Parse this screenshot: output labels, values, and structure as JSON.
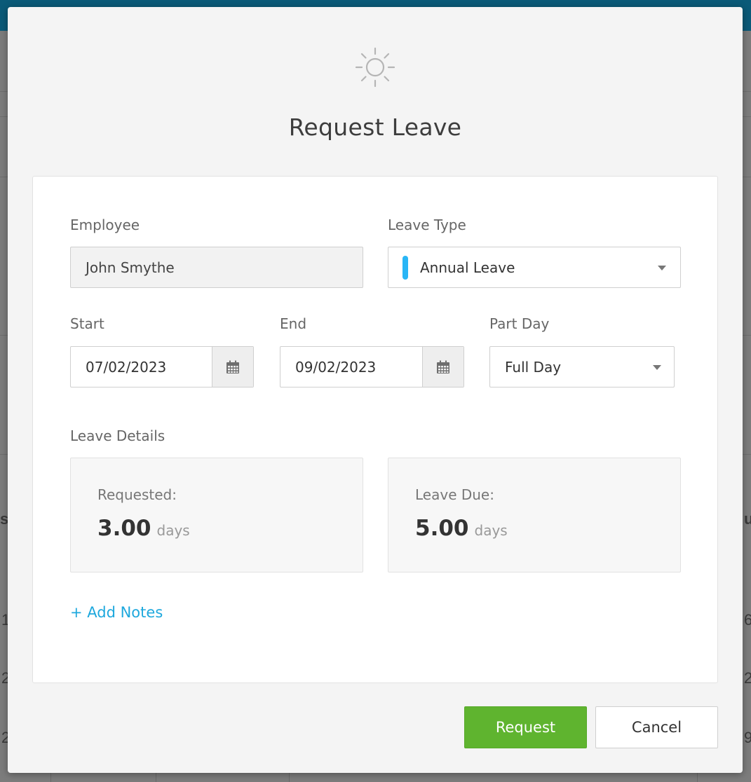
{
  "background": {
    "fragments": [
      "s",
      "1",
      "2",
      "2",
      "u",
      "6",
      "2",
      "9"
    ]
  },
  "modal": {
    "icon": "sun-icon",
    "title": "Request Leave"
  },
  "form": {
    "employee": {
      "label": "Employee",
      "value": "John Smythe"
    },
    "leave_type": {
      "label": "Leave Type",
      "value": "Annual Leave",
      "color": "#29b6f6"
    },
    "start": {
      "label": "Start",
      "value": "07/02/2023",
      "icon": "calendar-icon"
    },
    "end": {
      "label": "End",
      "value": "09/02/2023",
      "icon": "calendar-icon"
    },
    "part_day": {
      "label": "Part Day",
      "value": "Full Day"
    },
    "leave_details": {
      "label": "Leave Details",
      "requested": {
        "label": "Requested:",
        "value": "3.00",
        "unit": "days"
      },
      "leave_due": {
        "label": "Leave Due:",
        "value": "5.00",
        "unit": "days"
      }
    },
    "add_notes": "+ Add Notes"
  },
  "actions": {
    "request_label": "Request",
    "cancel_label": "Cancel"
  },
  "colors": {
    "primary_button": "#5fb42f",
    "link": "#1ea8dd",
    "top_bar": "#0b5a78"
  }
}
